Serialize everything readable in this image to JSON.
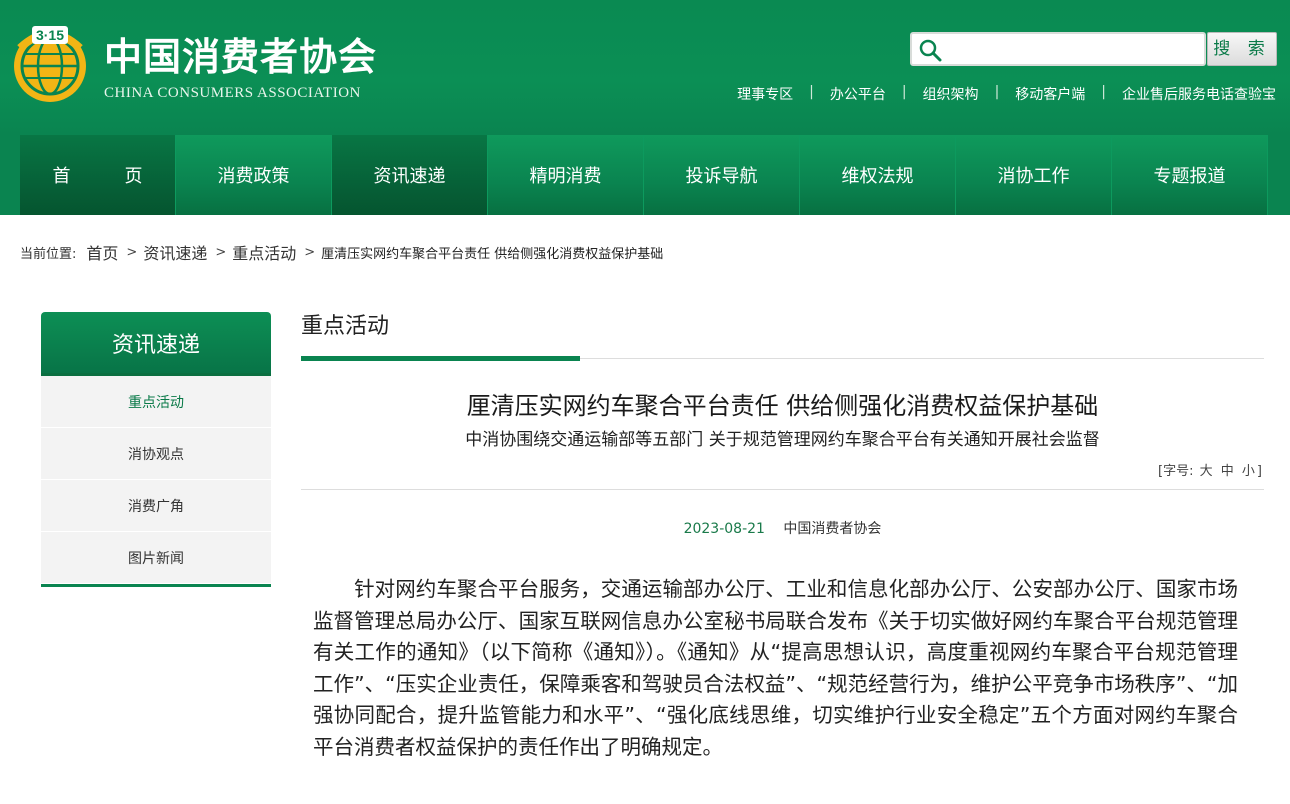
{
  "header": {
    "logo_cn": "中国消费者协会",
    "logo_en": "CHINA CONSUMERS ASSOCIATION",
    "logo_emblem_text": "3·15",
    "search": {
      "placeholder": "",
      "button_label": "搜 索"
    },
    "toplinks": [
      "理事专区",
      "办公平台",
      "组织架构",
      "移动客户端",
      "企业售后服务电话查验宝"
    ],
    "separator": "|"
  },
  "nav": {
    "items": [
      "首　页",
      "消费政策",
      "资讯速递",
      "精明消费",
      "投诉导航",
      "维权法规",
      "消协工作",
      "专题报道"
    ],
    "active_index": 2
  },
  "breadcrumb": {
    "label": "当前位置:",
    "items": [
      "首页",
      "资讯速递",
      "重点活动"
    ],
    "current": "厘清压实网约车聚合平台责任 供给侧强化消费权益保护基础",
    "separator": ">"
  },
  "sidebar": {
    "title": "资讯速递",
    "items": [
      "重点活动",
      "消协观点",
      "消费广角",
      "图片新闻"
    ],
    "active_index": 0
  },
  "main": {
    "section_title": "重点活动",
    "article": {
      "title": "厘清压实网约车聚合平台责任 供给侧强化消费权益保护基础",
      "subtitle": "中消协围绕交通运输部等五部门 关于规范管理网约车聚合平台有关通知开展社会监督",
      "font_size": {
        "open": "[字号:",
        "large": "大",
        "medium": "中",
        "small": "小",
        "close": "]"
      },
      "date": "2023-08-21",
      "source": "中国消费者协会",
      "paragraph": "　　针对网约车聚合平台服务，交通运输部办公厅、工业和信息化部办公厅、公安部办公厅、国家市场监督管理总局办公厅、国家互联网信息办公室秘书局联合发布《关于切实做好网约车聚合平台规范管理有关工作的通知》（以下简称《通知》）。《通知》从“提高思想认识，高度重视网约车聚合平台规范管理工作”、“压实企业责任，保障乘客和驾驶员合法权益”、“规范经营行为，维护公平竞争市场秩序”、“加强协同配合，提升监管能力和水平”、“强化底线思维，切实维护行业安全稳定”五个方面对网约车聚合平台消费者权益保护的责任作出了明确规定。"
    }
  },
  "colors": {
    "brand_green": "#0a8450",
    "accent_dark": "#065e36",
    "date_green": "#1a7a4a"
  }
}
